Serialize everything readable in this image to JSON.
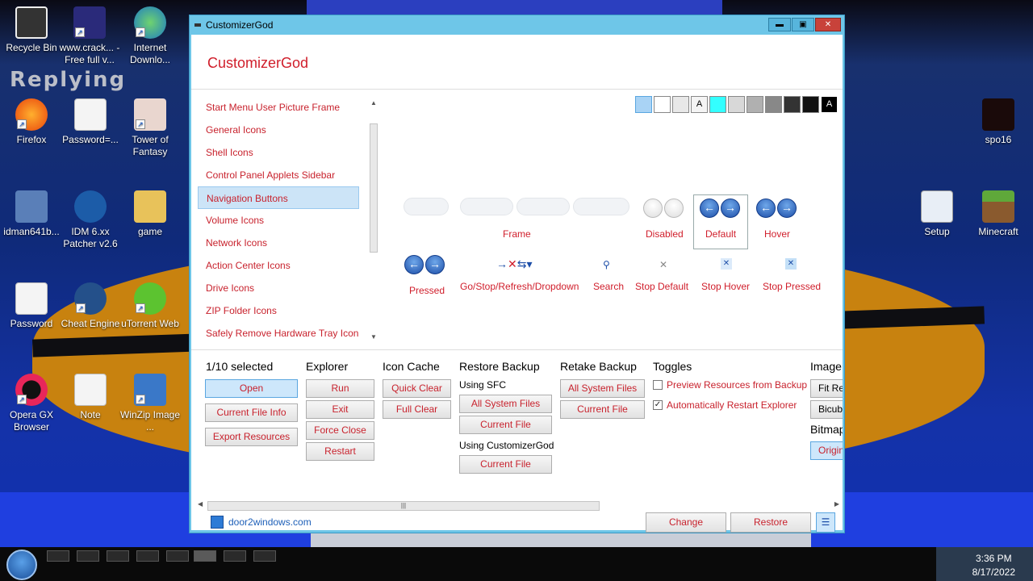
{
  "desktop": {
    "wallpaper_text": "Replying",
    "icons": [
      {
        "label": "Recycle Bin",
        "x_col": 0
      },
      {
        "label": "www.crack... - Free full v..."
      },
      {
        "label": "Internet Downlo..."
      },
      {
        "label": "Firefox"
      },
      {
        "label": "Password=..."
      },
      {
        "label": "Tower of Fantasy"
      },
      {
        "label": "idman641b..."
      },
      {
        "label": "IDM 6.xx Patcher v2.6"
      },
      {
        "label": "game"
      },
      {
        "label": "Password"
      },
      {
        "label": "Cheat Engine"
      },
      {
        "label": "uTorrent Web"
      },
      {
        "label": "Opera GX Browser"
      },
      {
        "label": "Note"
      },
      {
        "label": "WinZip Image ..."
      },
      {
        "label": "spo16"
      },
      {
        "label": "Setup"
      },
      {
        "label": "Minecraft"
      }
    ]
  },
  "window": {
    "title": "CustomizerGod",
    "header": "CustomizerGod",
    "controls": {
      "minimize": "▬",
      "maximize": "▣",
      "close": "✕"
    },
    "categories": [
      "Start Menu User Picture Frame",
      "General Icons",
      "Shell Icons",
      "Control Panel Applets Sidebar",
      "Navigation Buttons",
      "Volume Icons",
      "Network Icons",
      "Action Center Icons",
      "Drive Icons",
      "ZIP Folder Icons",
      "Safely Remove Hardware Tray Icon"
    ],
    "selected_category_index": 4,
    "swatch_colors": [
      "#a9d3f5",
      "#ffffff",
      "#e8e8e8",
      "#f4f4f4",
      "#33ffff",
      "#d8d8d8",
      "#b0b0b0",
      "#888888",
      "#333333",
      "#111111",
      "#000000"
    ],
    "swatch_text": "A",
    "preview": {
      "frame_label": "Frame",
      "disabled_label": "Disabled",
      "default_label": "Default",
      "hover_label": "Hover",
      "pressed_label": "Pressed",
      "gostop_label": "Go/Stop/Refresh/Dropdown",
      "search_label": "Search",
      "stop_default_label": "Stop Default",
      "stop_hover_label": "Stop Hover",
      "stop_pressed_label": "Stop Pressed",
      "back_glyph": "←",
      "forward_glyph": "→"
    },
    "panel": {
      "selected_count": "1/10 selected",
      "open": "Open",
      "current_file_info": "Current File Info",
      "export_resources": "Export Resources",
      "explorer_title": "Explorer",
      "run": "Run",
      "exit": "Exit",
      "force_close": "Force Close",
      "restart": "Restart",
      "icon_cache_title": "Icon Cache",
      "quick_clear": "Quick Clear",
      "full_clear": "Full Clear",
      "restore_backup_title": "Restore Backup",
      "using_sfc": "Using SFC",
      "all_system_files": "All System Files",
      "current_file": "Current File",
      "using_customizergod": "Using CustomizerGod",
      "retake_backup_title": "Retake Backup",
      "toggles_title": "Toggles",
      "preview_resources": "Preview Resources from Backup",
      "preview_resources_checked": false,
      "auto_restart": "Automatically Restart Explorer",
      "auto_restart_checked": true,
      "image_title": "Image",
      "fit_re": "Fit Re",
      "bicub": "Bicub",
      "bitmap_title": "Bitmap",
      "origin": "Origin"
    },
    "footer": {
      "link": "door2windows.com",
      "change": "Change",
      "restore": "Restore",
      "menu": "☰"
    }
  },
  "taskbar": {
    "time": "3:36 PM",
    "date": "8/17/2022"
  }
}
